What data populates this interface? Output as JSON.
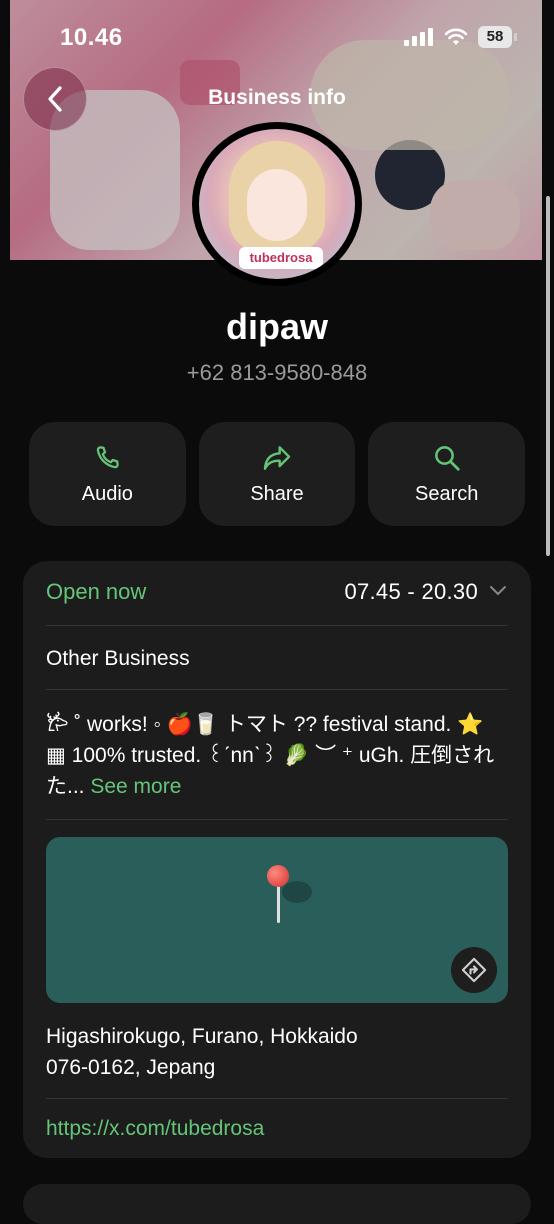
{
  "status_bar": {
    "time": "10.46",
    "battery": "58"
  },
  "header": {
    "title": "Business info"
  },
  "profile": {
    "name": "dipaw",
    "phone": "+62 813-9580-848",
    "avatar_tag": "tubedrosa"
  },
  "actions": [
    {
      "label": "Audio",
      "icon": "phone-icon"
    },
    {
      "label": "Share",
      "icon": "share-arrow-icon"
    },
    {
      "label": "Search",
      "icon": "search-icon"
    }
  ],
  "business": {
    "status": "Open now",
    "hours": "07.45 - 20.30",
    "category": "Other Business",
    "description": "𐂂 ˚ works! ◦ 🍎🥛 トマト ?? festival stand. ⭐ ▦ 100% trusted. ꒰ˊnnˋ꒱ 🥬 ︶ ⁺ uGh. 圧倒された...",
    "see_more": "See more",
    "address_line1": "Higashirokugo, Furano, Hokkaido",
    "address_line2": "076-0162, Jepang",
    "website": "https://x.com/tubedrosa"
  },
  "colors": {
    "accent": "#64c579",
    "background": "#0b0b0b",
    "card": "#1c1c1c",
    "map": "#2a5e5a"
  }
}
